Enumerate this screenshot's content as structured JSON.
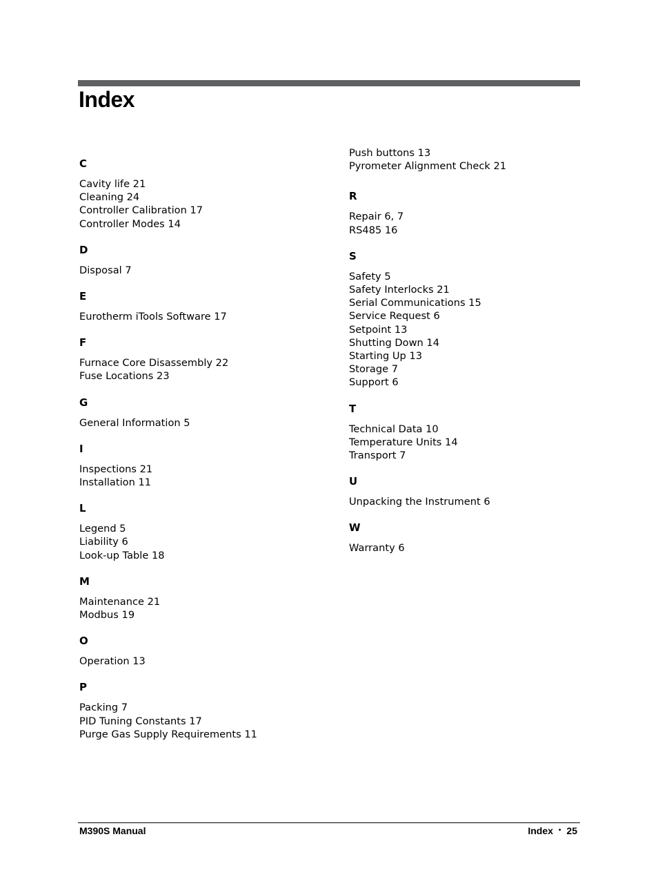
{
  "page": {
    "title": "Index",
    "footer": {
      "manual_name": "M390S Manual",
      "section": "Index",
      "separator": "•",
      "page_number": "25"
    }
  },
  "left_column": [
    {
      "letter": "C",
      "entries": [
        "Cavity life 21",
        "Cleaning 24",
        "Controller Calibration 17",
        "Controller Modes 14"
      ]
    },
    {
      "letter": "D",
      "entries": [
        "Disposal 7"
      ]
    },
    {
      "letter": "E",
      "entries": [
        "Eurotherm iTools Software 17"
      ]
    },
    {
      "letter": "F",
      "entries": [
        "Furnace Core Disassembly 22",
        "Fuse Locations 23"
      ]
    },
    {
      "letter": "G",
      "entries": [
        "General Information 5"
      ]
    },
    {
      "letter": "I",
      "entries": [
        "Inspections 21",
        "Installation 11"
      ]
    },
    {
      "letter": "L",
      "entries": [
        "Legend 5",
        "Liability 6",
        "Look-up Table 18"
      ]
    },
    {
      "letter": "M",
      "entries": [
        "Maintenance 21",
        "Modbus 19"
      ]
    },
    {
      "letter": "O",
      "entries": [
        "Operation 13"
      ]
    },
    {
      "letter": "P",
      "entries": [
        "Packing 7",
        "PID Tuning Constants 17",
        "Purge Gas Supply Requirements 11"
      ]
    }
  ],
  "right_column": {
    "continued_entries": [
      "Push buttons 13",
      "Pyrometer Alignment Check 21"
    ],
    "sections": [
      {
        "letter": "R",
        "entries": [
          "Repair 6, 7",
          "RS485 16"
        ]
      },
      {
        "letter": "S",
        "entries": [
          "Safety 5",
          "Safety Interlocks 21",
          "Serial Communications 15",
          "Service Request 6",
          "Setpoint 13",
          "Shutting Down 14",
          "Starting Up 13",
          "Storage 7",
          "Support 6"
        ]
      },
      {
        "letter": "T",
        "entries": [
          "Technical Data 10",
          "Temperature Units 14",
          "Transport 7"
        ]
      },
      {
        "letter": "U",
        "entries": [
          "Unpacking the Instrument 6"
        ]
      },
      {
        "letter": "W",
        "entries": [
          "Warranty 6"
        ]
      }
    ]
  }
}
